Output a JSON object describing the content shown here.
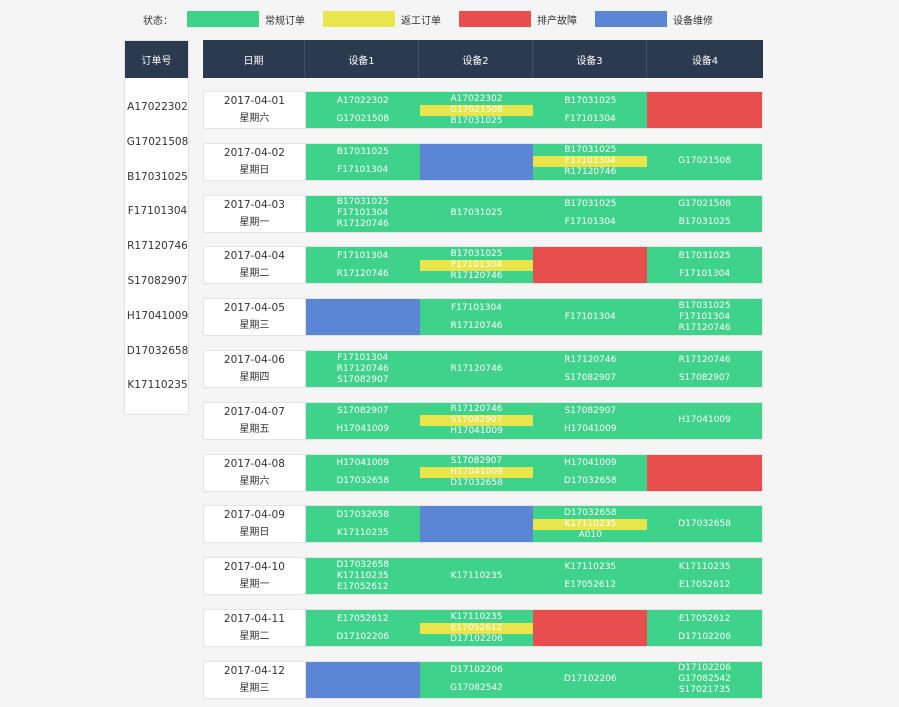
{
  "legend": {
    "title": "状态：",
    "items": [
      {
        "label": "常规订单",
        "color": "#3ed28a"
      },
      {
        "label": "返工订单",
        "color": "#e8e64c"
      },
      {
        "label": "排产故障",
        "color": "#e94e4e"
      },
      {
        "label": "设备维修",
        "color": "#5b86d6"
      }
    ]
  },
  "orders": {
    "header": "订单号",
    "items": [
      "A17022302",
      "G17021508",
      "B17031025",
      "F17101304",
      "R17120746",
      "S17082907",
      "H17041009",
      "D17032658",
      "K17110235"
    ]
  },
  "grid": {
    "headers": [
      "日期",
      "设备1",
      "设备2",
      "设备3",
      "设备4"
    ],
    "rows": [
      {
        "date": "2017-04-01",
        "weekday": "星期六",
        "cells": [
          {
            "s": "green",
            "lines": [
              {
                "t": "A17022302"
              },
              {
                "t": "G17021508"
              }
            ]
          },
          {
            "s": "green",
            "lines": [
              {
                "t": "A17022302"
              },
              {
                "t": "G17021508",
                "y": true
              },
              {
                "t": "B17031025"
              }
            ]
          },
          {
            "s": "green",
            "lines": [
              {
                "t": "B17031025"
              },
              {
                "t": "F17101304"
              }
            ]
          },
          {
            "s": "red",
            "lines": []
          }
        ]
      },
      {
        "date": "2017-04-02",
        "weekday": "星期日",
        "cells": [
          {
            "s": "green",
            "lines": [
              {
                "t": "B17031025"
              },
              {
                "t": "F17101304"
              }
            ]
          },
          {
            "s": "blue",
            "lines": []
          },
          {
            "s": "green",
            "lines": [
              {
                "t": "B17031025"
              },
              {
                "t": "F17101304",
                "y": true
              },
              {
                "t": "R17120746"
              }
            ]
          },
          {
            "s": "green",
            "lines": [
              {
                "t": "G17021508"
              }
            ]
          }
        ]
      },
      {
        "date": "2017-04-03",
        "weekday": "星期一",
        "cells": [
          {
            "s": "green",
            "lines": [
              {
                "t": "B17031025"
              },
              {
                "t": "F17101304"
              },
              {
                "t": "R17120746"
              }
            ]
          },
          {
            "s": "green",
            "lines": [
              {
                "t": "B17031025"
              }
            ]
          },
          {
            "s": "green",
            "lines": [
              {
                "t": "B17031025"
              },
              {
                "t": "F17101304"
              }
            ]
          },
          {
            "s": "green",
            "lines": [
              {
                "t": "G17021508"
              },
              {
                "t": "B17031025"
              }
            ]
          }
        ]
      },
      {
        "date": "2017-04-04",
        "weekday": "星期二",
        "cells": [
          {
            "s": "green",
            "lines": [
              {
                "t": "F17101304"
              },
              {
                "t": "R17120746"
              }
            ]
          },
          {
            "s": "green",
            "lines": [
              {
                "t": "B17031025"
              },
              {
                "t": "F17101304",
                "y": true
              },
              {
                "t": "R17120746"
              }
            ]
          },
          {
            "s": "red",
            "lines": []
          },
          {
            "s": "green",
            "lines": [
              {
                "t": "B17031025"
              },
              {
                "t": "F17101304"
              }
            ]
          }
        ]
      },
      {
        "date": "2017-04-05",
        "weekday": "星期三",
        "cells": [
          {
            "s": "blue",
            "lines": []
          },
          {
            "s": "green",
            "lines": [
              {
                "t": "F17101304"
              },
              {
                "t": "R17120746"
              }
            ]
          },
          {
            "s": "green",
            "lines": [
              {
                "t": "F17101304"
              }
            ]
          },
          {
            "s": "green",
            "lines": [
              {
                "t": "B17031025"
              },
              {
                "t": "F17101304"
              },
              {
                "t": "R17120746"
              }
            ]
          }
        ]
      },
      {
        "date": "2017-04-06",
        "weekday": "星期四",
        "cells": [
          {
            "s": "green",
            "lines": [
              {
                "t": "F17101304"
              },
              {
                "t": "R17120746"
              },
              {
                "t": "S17082907"
              }
            ]
          },
          {
            "s": "green",
            "lines": [
              {
                "t": "R17120746"
              }
            ]
          },
          {
            "s": "green",
            "lines": [
              {
                "t": "R17120746"
              },
              {
                "t": "S17082907"
              }
            ]
          },
          {
            "s": "green",
            "lines": [
              {
                "t": "R17120746"
              },
              {
                "t": "S17082907"
              }
            ]
          }
        ]
      },
      {
        "date": "2017-04-07",
        "weekday": "星期五",
        "cells": [
          {
            "s": "green",
            "lines": [
              {
                "t": "S17082907"
              },
              {
                "t": "H17041009"
              }
            ]
          },
          {
            "s": "green",
            "lines": [
              {
                "t": "R17120746"
              },
              {
                "t": "S17082907",
                "y": true
              },
              {
                "t": "H17041009"
              }
            ]
          },
          {
            "s": "green",
            "lines": [
              {
                "t": "S17082907"
              },
              {
                "t": "H17041009"
              }
            ]
          },
          {
            "s": "green",
            "lines": [
              {
                "t": "H17041009"
              }
            ]
          }
        ]
      },
      {
        "date": "2017-04-08",
        "weekday": "星期六",
        "cells": [
          {
            "s": "green",
            "lines": [
              {
                "t": "H17041009"
              },
              {
                "t": "D17032658"
              }
            ]
          },
          {
            "s": "green",
            "lines": [
              {
                "t": "S17082907"
              },
              {
                "t": "H17041009",
                "y": true
              },
              {
                "t": "D17032658"
              }
            ]
          },
          {
            "s": "green",
            "lines": [
              {
                "t": "H17041009"
              },
              {
                "t": "D17032658"
              }
            ]
          },
          {
            "s": "red",
            "lines": []
          }
        ]
      },
      {
        "date": "2017-04-09",
        "weekday": "星期日",
        "cells": [
          {
            "s": "green",
            "lines": [
              {
                "t": "D17032658"
              },
              {
                "t": "K17110235"
              }
            ]
          },
          {
            "s": "blue",
            "lines": []
          },
          {
            "s": "green",
            "lines": [
              {
                "t": "D17032658"
              },
              {
                "t": "K17110235",
                "y": true
              },
              {
                "t": "A010"
              }
            ]
          },
          {
            "s": "green",
            "lines": [
              {
                "t": "D17032658"
              }
            ]
          }
        ]
      },
      {
        "date": "2017-04-10",
        "weekday": "星期一",
        "cells": [
          {
            "s": "green",
            "lines": [
              {
                "t": "D17032658"
              },
              {
                "t": "K17110235"
              },
              {
                "t": "E17052612"
              }
            ]
          },
          {
            "s": "green",
            "lines": [
              {
                "t": "K17110235"
              }
            ]
          },
          {
            "s": "green",
            "lines": [
              {
                "t": "K17110235"
              },
              {
                "t": "E17052612"
              }
            ]
          },
          {
            "s": "green",
            "lines": [
              {
                "t": "K17110235"
              },
              {
                "t": "E17052612"
              }
            ]
          }
        ]
      },
      {
        "date": "2017-04-11",
        "weekday": "星期二",
        "cells": [
          {
            "s": "green",
            "lines": [
              {
                "t": "E17052612"
              },
              {
                "t": "D17102206"
              }
            ]
          },
          {
            "s": "green",
            "lines": [
              {
                "t": "K17110235"
              },
              {
                "t": "E17052612",
                "y": true
              },
              {
                "t": "D17102206"
              }
            ]
          },
          {
            "s": "red",
            "lines": []
          },
          {
            "s": "green",
            "lines": [
              {
                "t": "E17052612"
              },
              {
                "t": "D17102206"
              }
            ]
          }
        ]
      },
      {
        "date": "2017-04-12",
        "weekday": "星期三",
        "cells": [
          {
            "s": "blue",
            "lines": []
          },
          {
            "s": "green",
            "lines": [
              {
                "t": "D17102206"
              },
              {
                "t": "G17082542"
              }
            ]
          },
          {
            "s": "green",
            "lines": [
              {
                "t": "D17102206"
              }
            ]
          },
          {
            "s": "green",
            "lines": [
              {
                "t": "D17102206"
              },
              {
                "t": "G17082542"
              },
              {
                "t": "S17021735"
              }
            ]
          }
        ]
      }
    ]
  }
}
